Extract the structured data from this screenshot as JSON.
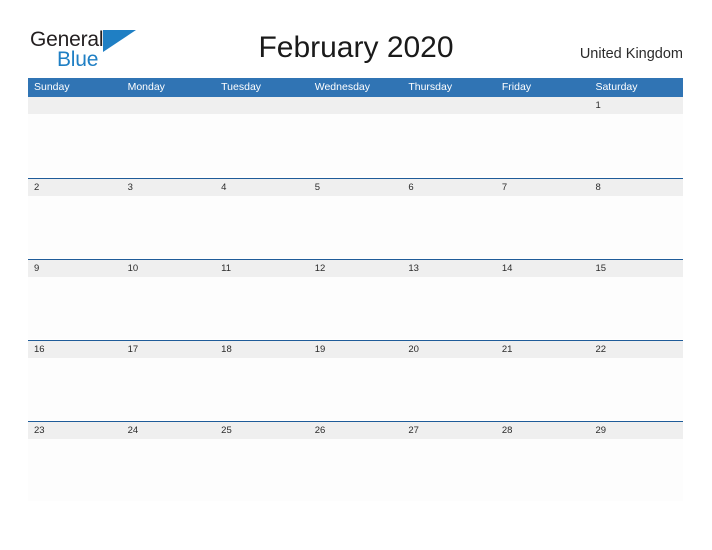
{
  "brand": {
    "name_top": "General",
    "name_bottom": "Blue",
    "color_text": "#231f20",
    "color_accent": "#1f7fc4"
  },
  "header": {
    "title": "February 2020",
    "country": "United Kingdom"
  },
  "theme": {
    "header_blue": "#3074b4",
    "separator_blue": "#1f5c99",
    "date_strip_gray": "#efefef",
    "text_dark": "#2b2b2b"
  },
  "calendar": {
    "month": "February",
    "year": "2020",
    "weekdays": [
      "Sunday",
      "Monday",
      "Tuesday",
      "Wednesday",
      "Thursday",
      "Friday",
      "Saturday"
    ],
    "weeks": [
      {
        "days": [
          "",
          "",
          "",
          "",
          "",
          "",
          "1"
        ]
      },
      {
        "days": [
          "2",
          "3",
          "4",
          "5",
          "6",
          "7",
          "8"
        ]
      },
      {
        "days": [
          "9",
          "10",
          "11",
          "12",
          "13",
          "14",
          "15"
        ]
      },
      {
        "days": [
          "16",
          "17",
          "18",
          "19",
          "20",
          "21",
          "22"
        ]
      },
      {
        "days": [
          "23",
          "24",
          "25",
          "26",
          "27",
          "28",
          "29"
        ]
      }
    ]
  }
}
